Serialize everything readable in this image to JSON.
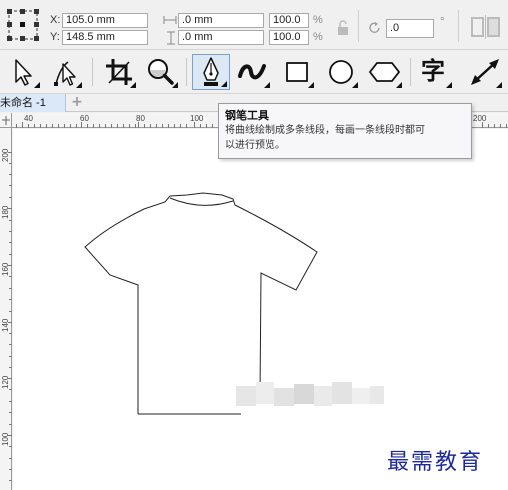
{
  "property_bar": {
    "x_label": "X:",
    "x_value": "105.0 mm",
    "y_label": "Y:",
    "y_value": "148.5 mm",
    "width_value": ".0 mm",
    "height_value": ".0 mm",
    "scale_x": "100.0",
    "scale_y": "100.0",
    "percent_symbol": "%",
    "rotation_value": ".0",
    "degree_symbol": "°"
  },
  "toolbox": {
    "tools": [
      {
        "name": "pick-tool",
        "icon": "arrow-cursor-icon"
      },
      {
        "name": "shape-tool",
        "icon": "shape-edit-icon"
      },
      {
        "name": "crop-tool",
        "icon": "crop-icon"
      },
      {
        "name": "zoom-tool",
        "icon": "magnifier-icon"
      },
      {
        "name": "pen-tool",
        "icon": "pen-nib-icon",
        "active": true
      },
      {
        "name": "artistic-media-tool",
        "icon": "brush-stroke-icon"
      },
      {
        "name": "rectangle-tool",
        "icon": "rectangle-icon"
      },
      {
        "name": "ellipse-tool",
        "icon": "ellipse-icon"
      },
      {
        "name": "polygon-tool",
        "icon": "hexagon-icon"
      },
      {
        "name": "text-tool",
        "icon": "text-icon",
        "glyph": "字"
      },
      {
        "name": "dimension-tool",
        "icon": "dimension-icon"
      }
    ]
  },
  "document_tab": {
    "label": "未命名 -1",
    "add_symbol": "+"
  },
  "rulers": {
    "horizontal_ticks": [
      "40",
      "60",
      "80",
      "100",
      "200"
    ],
    "vertical_ticks": [
      "200",
      "180",
      "160",
      "140",
      "120",
      "100"
    ]
  },
  "tooltip": {
    "title": "钢笔工具",
    "line1": "将曲线绘制成多条线段，每画一条线段时都可",
    "line2": "以进行预览。"
  },
  "watermark": "最需教育",
  "colors": {
    "tooltip_bg": "#f7f7f9",
    "active_tool_bg": "#dde8f5",
    "watermark": "#1f2a9a"
  }
}
